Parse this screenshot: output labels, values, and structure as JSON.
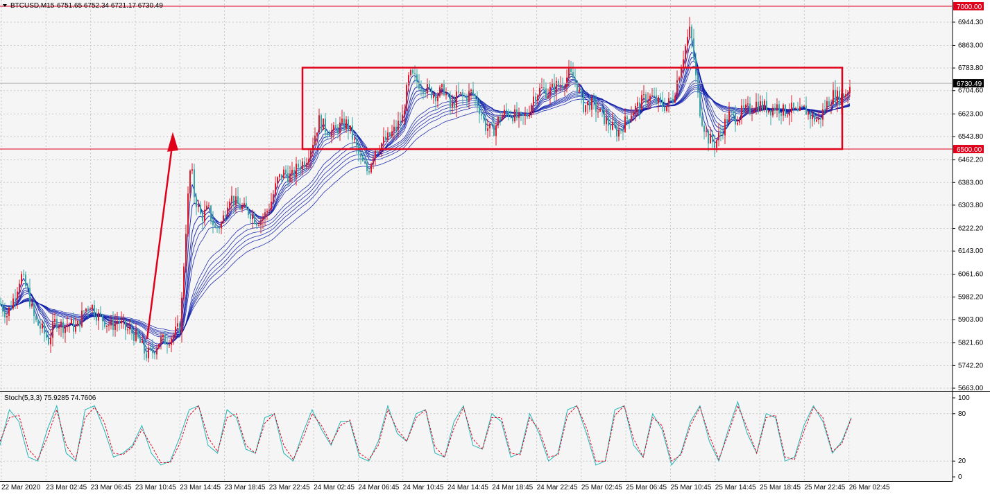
{
  "header": {
    "symbol": "BTCUSD,M15",
    "ohlc": "6751.65 6752.34 6721.17 6730.49"
  },
  "colors": {
    "background": "#f5f5f5",
    "grid": "#c8c8c8",
    "bull_candle": "#e0192b",
    "bear_candle": "#38a6a6",
    "ma_ribbon": "#0a1aa8",
    "annotation": "#e0001a",
    "stoch_main": "#22b5b5",
    "stoch_signal": "#e0001a"
  },
  "chart_data": [
    {
      "type": "candlestick",
      "symbol": "BTCUSD",
      "timeframe": "M15",
      "y_ticks": [
        "6944.30",
        "6863.00",
        "6783.80",
        "6704.60",
        "6623.00",
        "6543.80",
        "6462.20",
        "6383.00",
        "6303.80",
        "6222.20",
        "6143.00",
        "6061.60",
        "5982.20",
        "5903.00",
        "5821.60",
        "5742.20",
        "5663.00"
      ],
      "ylim": [
        5663.0,
        7000.0
      ],
      "x_ticks": [
        "22 Mar 2020",
        "23 Mar 02:45",
        "23 Mar 06:45",
        "23 Mar 10:45",
        "23 Mar 14:45",
        "23 Mar 18:45",
        "23 Mar 22:45",
        "24 Mar 02:45",
        "24 Mar 06:45",
        "24 Mar 10:45",
        "24 Mar 14:45",
        "24 Mar 18:45",
        "24 Mar 22:45",
        "25 Mar 02:45",
        "25 Mar 06:45",
        "25 Mar 10:45",
        "25 Mar 14:45",
        "25 Mar 18:45",
        "25 Mar 22:45",
        "26 Mar 02:45"
      ],
      "price_levels": [
        {
          "label": "7000.00",
          "value": 7000.0
        },
        {
          "label": "6500.00",
          "value": 6500.0
        }
      ],
      "current_price": {
        "label": "6730.49",
        "value": 6730.49
      },
      "close_path": [
        [
          0,
          5960
        ],
        [
          10,
          5920
        ],
        [
          20,
          5980
        ],
        [
          30,
          6060
        ],
        [
          40,
          6000
        ],
        [
          50,
          5900
        ],
        [
          60,
          5870
        ],
        [
          70,
          5830
        ],
        [
          80,
          5900
        ],
        [
          90,
          5880
        ],
        [
          100,
          5890
        ],
        [
          110,
          5870
        ],
        [
          120,
          5930
        ],
        [
          130,
          5960
        ],
        [
          140,
          5920
        ],
        [
          150,
          5900
        ],
        [
          160,
          5880
        ],
        [
          170,
          5900
        ],
        [
          180,
          5870
        ],
        [
          190,
          5860
        ],
        [
          200,
          5830
        ],
        [
          210,
          5780
        ],
        [
          220,
          5790
        ],
        [
          230,
          5830
        ],
        [
          240,
          5830
        ],
        [
          250,
          5850
        ],
        [
          260,
          5880
        ],
        [
          265,
          6100
        ],
        [
          270,
          6300
        ],
        [
          275,
          6450
        ],
        [
          280,
          6340
        ],
        [
          290,
          6260
        ],
        [
          300,
          6290
        ],
        [
          310,
          6220
        ],
        [
          320,
          6240
        ],
        [
          330,
          6340
        ],
        [
          340,
          6310
        ],
        [
          350,
          6290
        ],
        [
          360,
          6280
        ],
        [
          370,
          6250
        ],
        [
          380,
          6260
        ],
        [
          390,
          6310
        ],
        [
          400,
          6390
        ],
        [
          410,
          6420
        ],
        [
          420,
          6400
        ],
        [
          430,
          6440
        ],
        [
          440,
          6460
        ],
        [
          450,
          6520
        ],
        [
          460,
          6600
        ],
        [
          470,
          6570
        ],
        [
          480,
          6560
        ],
        [
          490,
          6580
        ],
        [
          500,
          6590
        ],
        [
          510,
          6530
        ],
        [
          520,
          6460
        ],
        [
          530,
          6420
        ],
        [
          540,
          6500
        ],
        [
          550,
          6520
        ],
        [
          560,
          6540
        ],
        [
          570,
          6570
        ],
        [
          580,
          6610
        ],
        [
          590,
          6760
        ],
        [
          600,
          6740
        ],
        [
          610,
          6720
        ],
        [
          620,
          6700
        ],
        [
          630,
          6690
        ],
        [
          640,
          6710
        ],
        [
          650,
          6640
        ],
        [
          660,
          6690
        ],
        [
          670,
          6680
        ],
        [
          680,
          6700
        ],
        [
          690,
          6650
        ],
        [
          700,
          6580
        ],
        [
          710,
          6560
        ],
        [
          720,
          6610
        ],
        [
          730,
          6630
        ],
        [
          740,
          6620
        ],
        [
          750,
          6600
        ],
        [
          760,
          6620
        ],
        [
          770,
          6690
        ],
        [
          780,
          6710
        ],
        [
          790,
          6700
        ],
        [
          800,
          6720
        ],
        [
          810,
          6730
        ],
        [
          820,
          6760
        ],
        [
          830,
          6740
        ],
        [
          840,
          6650
        ],
        [
          850,
          6660
        ],
        [
          860,
          6640
        ],
        [
          870,
          6610
        ],
        [
          880,
          6580
        ],
        [
          890,
          6560
        ],
        [
          900,
          6590
        ],
        [
          910,
          6630
        ],
        [
          920,
          6650
        ],
        [
          930,
          6680
        ],
        [
          940,
          6680
        ],
        [
          950,
          6660
        ],
        [
          960,
          6650
        ],
        [
          970,
          6680
        ],
        [
          980,
          6780
        ],
        [
          990,
          6880
        ],
        [
          995,
          6920
        ],
        [
          1000,
          6820
        ],
        [
          1005,
          6700
        ],
        [
          1010,
          6620
        ],
        [
          1020,
          6540
        ],
        [
          1030,
          6520
        ],
        [
          1040,
          6560
        ],
        [
          1050,
          6620
        ],
        [
          1060,
          6610
        ],
        [
          1070,
          6630
        ],
        [
          1080,
          6640
        ],
        [
          1090,
          6660
        ],
        [
          1100,
          6650
        ],
        [
          1110,
          6640
        ],
        [
          1120,
          6650
        ],
        [
          1130,
          6630
        ],
        [
          1140,
          6640
        ],
        [
          1150,
          6620
        ],
        [
          1160,
          6640
        ],
        [
          1170,
          6610
        ],
        [
          1180,
          6600
        ],
        [
          1190,
          6650
        ],
        [
          1200,
          6690
        ],
        [
          1210,
          6680
        ],
        [
          1220,
          6700
        ],
        [
          1227,
          6730
        ]
      ]
    },
    {
      "type": "line",
      "title": "Stoch(5,3,3) 75.9285 74.7606",
      "y_ticks": [
        "100",
        "80",
        "20",
        "0"
      ],
      "ylim": [
        0,
        100
      ],
      "series": [
        {
          "values": [
            40,
            85,
            70,
            25,
            20,
            60,
            90,
            30,
            20,
            85,
            90,
            60,
            25,
            30,
            40,
            65,
            30,
            15,
            20,
            50,
            85,
            90,
            40,
            30,
            85,
            75,
            35,
            30,
            75,
            80,
            30,
            20,
            55,
            85,
            60,
            40,
            70,
            70,
            25,
            20,
            45,
            90,
            55,
            45,
            80,
            85,
            30,
            25,
            70,
            90,
            40,
            35,
            80,
            70,
            25,
            30,
            80,
            55,
            20,
            30,
            85,
            90,
            55,
            15,
            20,
            85,
            90,
            40,
            25,
            80,
            60,
            15,
            30,
            70,
            90,
            45,
            20,
            60,
            95,
            55,
            30,
            80,
            75,
            20,
            25,
            65,
            90,
            70,
            30,
            45,
            75
          ]
        },
        {
          "values": [
            45,
            75,
            78,
            35,
            22,
            50,
            85,
            40,
            22,
            75,
            88,
            70,
            30,
            28,
            38,
            60,
            40,
            18,
            18,
            42,
            78,
            90,
            50,
            32,
            75,
            80,
            40,
            30,
            68,
            80,
            40,
            22,
            48,
            80,
            65,
            42,
            65,
            72,
            30,
            22,
            40,
            85,
            60,
            45,
            75,
            85,
            38,
            25,
            62,
            88,
            48,
            35,
            75,
            75,
            30,
            28,
            75,
            60,
            25,
            28,
            78,
            90,
            62,
            20,
            20,
            78,
            90,
            48,
            25,
            75,
            65,
            20,
            28,
            65,
            88,
            52,
            22,
            55,
            90,
            62,
            30,
            75,
            78,
            25,
            22,
            58,
            88,
            75,
            32,
            42,
            74
          ]
        }
      ]
    }
  ]
}
